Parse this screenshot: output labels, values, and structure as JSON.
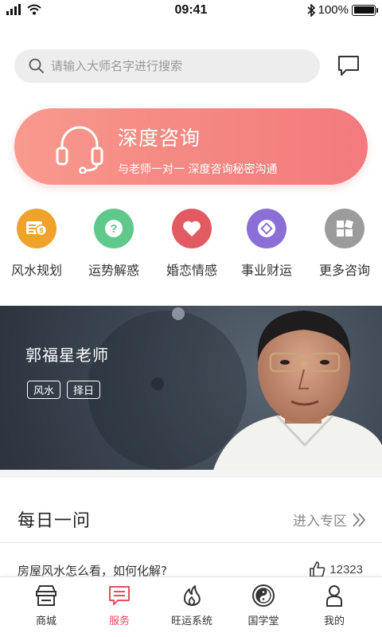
{
  "status_bar": {
    "time": "09:41",
    "battery": "100%"
  },
  "search": {
    "placeholder": "请输入大师名字进行搜索"
  },
  "banner": {
    "title": "深度咨询",
    "subtitle": "与老师一对一 深度咨询秘密沟通"
  },
  "categories": [
    {
      "label": "风水规划",
      "color": "#f0a22a",
      "icon": "feng-shui-icon"
    },
    {
      "label": "运势解惑",
      "color": "#5ec98a",
      "icon": "question-icon"
    },
    {
      "label": "婚恋情感",
      "color": "#e25b62",
      "icon": "heart-icon"
    },
    {
      "label": "事业财运",
      "color": "#8b6fd6",
      "icon": "coin-icon"
    },
    {
      "label": "更多咨询",
      "color": "#9c9c9c",
      "icon": "more-grid-icon"
    }
  ],
  "master": {
    "name": "郭福星老师",
    "tags": [
      "风水",
      "择日"
    ]
  },
  "daily": {
    "title": "每日一问",
    "enter_label": "进入专区",
    "question": "房屋风水怎么看，如何化解?",
    "likes": "12323"
  },
  "tab_bar": {
    "active": "服务",
    "accent": "#e84a5f",
    "tabs": [
      {
        "label": "商城",
        "icon": "shop-icon"
      },
      {
        "label": "服务",
        "icon": "service-icon"
      },
      {
        "label": "旺运系统",
        "icon": "flame-icon"
      },
      {
        "label": "国学堂",
        "icon": "taiji-icon"
      },
      {
        "label": "我的",
        "icon": "profile-icon"
      }
    ]
  }
}
